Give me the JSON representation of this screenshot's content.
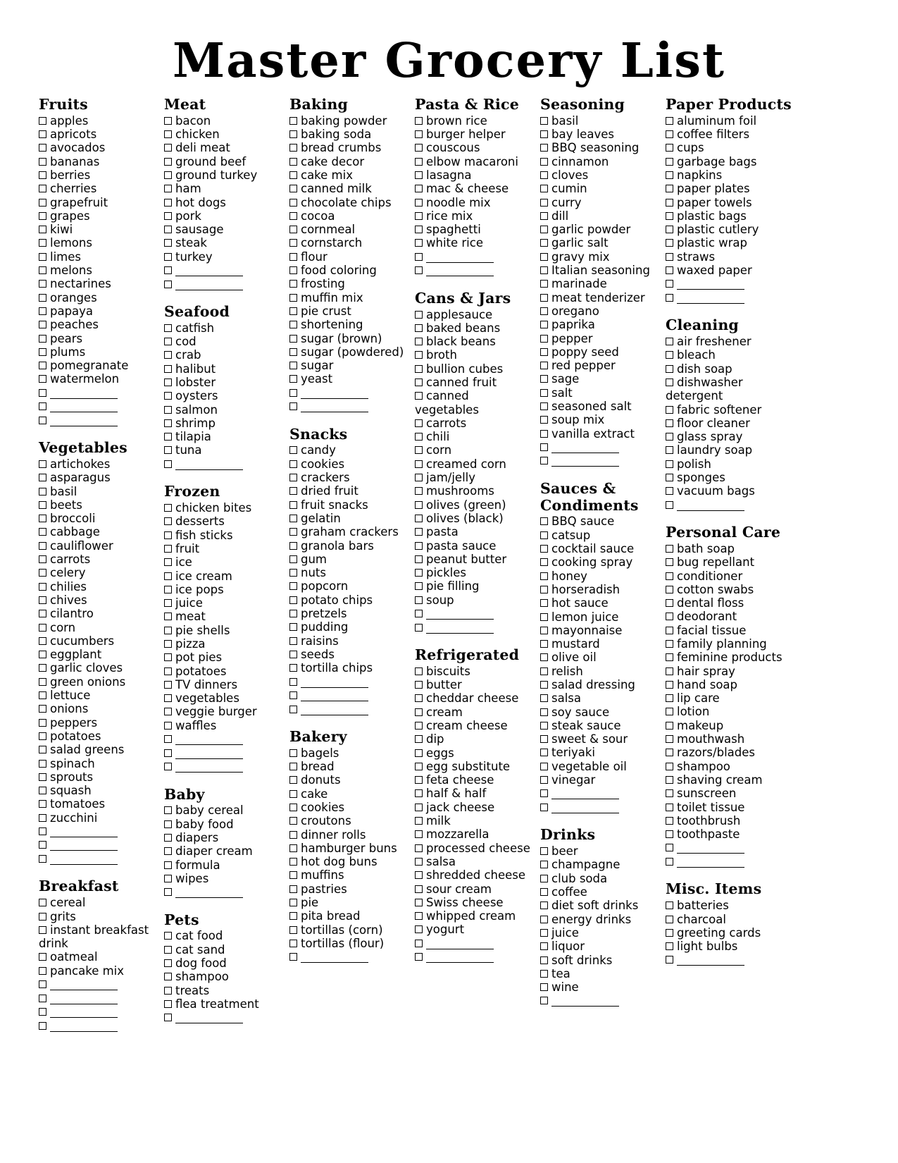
{
  "document": {
    "title": "Master Grocery List",
    "checkbox_icon": "checkbox-empty-icon",
    "blank_line_icon": "write-in-blank-line",
    "ink_color": "#000000",
    "paper_color": "#ffffff"
  },
  "columns": [
    {
      "name": "column-1",
      "sections": [
        {
          "title": "Fruits",
          "items": [
            "apples",
            "apricots",
            "avocados",
            "bananas",
            "berries",
            "cherries",
            "grapefruit",
            "grapes",
            "kiwi",
            "lemons",
            "limes",
            "melons",
            "nectarines",
            "oranges",
            "papaya",
            "peaches",
            "pears",
            "plums",
            "pomegranate",
            "watermelon"
          ],
          "blanks": 3
        },
        {
          "title": "Vegetables",
          "items": [
            "artichokes",
            "asparagus",
            "basil",
            "beets",
            "broccoli",
            "cabbage",
            "cauliflower",
            "carrots",
            "celery",
            "chilies",
            "chives",
            "cilantro",
            "corn",
            "cucumbers",
            "eggplant",
            "garlic cloves",
            "green onions",
            "lettuce",
            "onions",
            "peppers",
            "potatoes",
            "salad greens",
            "spinach",
            "sprouts",
            "squash",
            "tomatoes",
            "zucchini"
          ],
          "blanks": 3
        },
        {
          "title": "Breakfast",
          "items": [
            "cereal",
            "grits",
            "instant breakfast drink",
            "oatmeal",
            "pancake mix"
          ],
          "blanks": 4
        }
      ]
    },
    {
      "name": "column-2",
      "sections": [
        {
          "title": "Meat",
          "items": [
            "bacon",
            "chicken",
            "deli meat",
            "ground beef",
            "ground turkey",
            "ham",
            "hot dogs",
            "pork",
            "sausage",
            "steak",
            "turkey"
          ],
          "blanks": 2
        },
        {
          "title": "Seafood",
          "items": [
            "catfish",
            "cod",
            "crab",
            "halibut",
            "lobster",
            "oysters",
            "salmon",
            "shrimp",
            "tilapia",
            "tuna"
          ],
          "blanks": 1
        },
        {
          "title": "Frozen",
          "items": [
            "chicken bites",
            "desserts",
            "fish sticks",
            "fruit",
            "ice",
            "ice cream",
            "ice pops",
            "juice",
            "meat",
            "pie shells",
            "pizza",
            "pot pies",
            "potatoes",
            "TV dinners",
            "vegetables",
            "veggie burger",
            "waffles"
          ],
          "blanks": 3
        },
        {
          "title": "Baby",
          "items": [
            "baby cereal",
            "baby food",
            "diapers",
            "diaper cream",
            "formula",
            "wipes"
          ],
          "blanks": 1
        },
        {
          "title": "Pets",
          "items": [
            "cat food",
            "cat sand",
            "dog food",
            "shampoo",
            "treats",
            "flea treatment"
          ],
          "blanks": 1
        }
      ]
    },
    {
      "name": "column-3",
      "sections": [
        {
          "title": "Baking",
          "items": [
            "baking powder",
            "baking soda",
            "bread crumbs",
            "cake decor",
            "cake mix",
            "canned milk",
            "chocolate chips",
            "cocoa",
            "cornmeal",
            "cornstarch",
            "flour",
            "food coloring",
            "frosting",
            "muffin mix",
            "pie crust",
            "shortening",
            "sugar (brown)",
            "sugar (powdered)",
            "sugar",
            "yeast"
          ],
          "blanks": 2
        },
        {
          "title": "Snacks",
          "items": [
            "candy",
            "cookies",
            "crackers",
            "dried fruit",
            "fruit snacks",
            "gelatin",
            "graham crackers",
            "granola bars",
            "gum",
            "nuts",
            "popcorn",
            "potato chips",
            "pretzels",
            "pudding",
            "raisins",
            "seeds",
            "tortilla chips"
          ],
          "blanks": 3
        },
        {
          "title": "Bakery",
          "items": [
            "bagels",
            "bread",
            "donuts",
            "cake",
            "cookies",
            "croutons",
            "dinner rolls",
            "hamburger buns",
            "hot dog buns",
            "muffins",
            "pastries",
            "pie",
            "pita bread",
            "tortillas (corn)",
            "tortillas (flour)"
          ],
          "blanks": 1
        }
      ]
    },
    {
      "name": "column-4",
      "sections": [
        {
          "title": "Pasta & Rice",
          "items": [
            "brown rice",
            "burger helper",
            "couscous",
            "elbow macaroni",
            "lasagna",
            "mac & cheese",
            "noodle mix",
            "rice mix",
            "spaghetti",
            "white rice"
          ],
          "blanks": 2
        },
        {
          "title": "Cans & Jars",
          "items": [
            "applesauce",
            "baked beans",
            "black beans",
            "broth",
            "bullion cubes",
            "canned fruit",
            "canned vegetables",
            "carrots",
            "chili",
            "corn",
            "creamed corn",
            "jam/jelly",
            "mushrooms",
            "olives (green)",
            "olives (black)",
            "pasta",
            "pasta sauce",
            "peanut butter",
            "pickles",
            "pie filling",
            "soup"
          ],
          "blanks": 2
        },
        {
          "title": "Refrigerated",
          "items": [
            "biscuits",
            "butter",
            "cheddar cheese",
            "cream",
            "cream cheese",
            "dip",
            "eggs",
            "egg substitute",
            "feta cheese",
            "half & half",
            "jack cheese",
            "milk",
            "mozzarella",
            "processed cheese",
            "salsa",
            "shredded cheese",
            "sour cream",
            "Swiss cheese",
            "whipped cream",
            "yogurt"
          ],
          "blanks": 2
        }
      ]
    },
    {
      "name": "column-5",
      "sections": [
        {
          "title": "Seasoning",
          "items": [
            "basil",
            "bay leaves",
            "BBQ seasoning",
            "cinnamon",
            "cloves",
            "cumin",
            "curry",
            "dill",
            "garlic powder",
            "garlic salt",
            "gravy mix",
            "Italian seasoning",
            "marinade",
            "meat tenderizer",
            "oregano",
            "paprika",
            "pepper",
            "poppy seed",
            "red pepper",
            "sage",
            "salt",
            "seasoned salt",
            "soup mix",
            "vanilla extract"
          ],
          "blanks": 2
        },
        {
          "title": "Sauces & Condiments",
          "items": [
            "BBQ sauce",
            "catsup",
            "cocktail sauce",
            "cooking spray",
            "honey",
            "horseradish",
            "hot sauce",
            "lemon juice",
            "mayonnaise",
            "mustard",
            "olive oil",
            "relish",
            "salad dressing",
            "salsa",
            "soy sauce",
            "steak sauce",
            "sweet & sour",
            "teriyaki",
            "vegetable oil",
            "vinegar"
          ],
          "blanks": 2
        },
        {
          "title": "Drinks",
          "items": [
            "beer",
            "champagne",
            "club soda",
            "coffee",
            "diet soft drinks",
            "energy drinks",
            "juice",
            "liquor",
            "soft drinks",
            "tea",
            "wine"
          ],
          "blanks": 1
        }
      ]
    },
    {
      "name": "column-6",
      "sections": [
        {
          "title": "Paper Products",
          "items": [
            "aluminum foil",
            "coffee filters",
            "cups",
            "garbage bags",
            "napkins",
            "paper plates",
            "paper towels",
            "plastic bags",
            "plastic cutlery",
            "plastic wrap",
            "straws",
            "waxed paper"
          ],
          "blanks": 2
        },
        {
          "title": "Cleaning",
          "items": [
            "air freshener",
            "bleach",
            "dish soap",
            "dishwasher detergent",
            "fabric softener",
            "floor cleaner",
            "glass spray",
            "laundry soap",
            "polish",
            "sponges",
            "vacuum bags"
          ],
          "blanks": 1
        },
        {
          "title": "Personal Care",
          "items": [
            "bath soap",
            "bug repellant",
            "conditioner",
            "cotton swabs",
            "dental floss",
            "deodorant",
            "facial tissue",
            "family planning",
            "feminine products",
            "hair spray",
            "hand soap",
            "lip care",
            "lotion",
            "makeup",
            "mouthwash",
            "razors/blades",
            "shampoo",
            "shaving cream",
            "sunscreen",
            "toilet tissue",
            "toothbrush",
            "toothpaste"
          ],
          "blanks": 2
        },
        {
          "title": "Misc. Items",
          "items": [
            "batteries",
            "charcoal",
            "greeting cards",
            "light bulbs"
          ],
          "blanks": 1
        }
      ]
    }
  ]
}
